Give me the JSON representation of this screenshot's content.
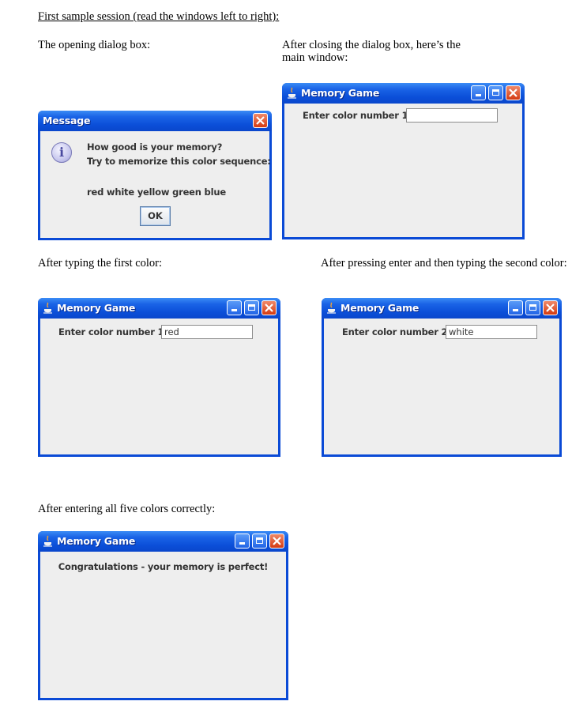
{
  "captions": {
    "heading": "First sample session (read the windows left to right):",
    "opening": "The opening dialog box:",
    "after_closing_1": "After closing the dialog box, here’s the",
    "after_closing_2": "main window:",
    "after_first": "After typing the first color:",
    "after_second": "After pressing enter and then typing the second color:",
    "after_all": "After entering all five colors correctly:"
  },
  "dialog": {
    "title": "Message",
    "line1": "How good is your memory?",
    "line2": "Try to memorize this color sequence:",
    "sequence": "red white yellow green blue",
    "ok_label": "OK",
    "icon": "info-icon"
  },
  "window_title": "Memory Game",
  "windows": {
    "main": {
      "label": "Enter color number 1:",
      "value": ""
    },
    "first": {
      "label": "Enter color number 1:",
      "value": "red"
    },
    "second": {
      "label": "Enter color number 2:",
      "value": "white"
    },
    "final": {
      "message": "Congratulations - your memory is perfect!"
    }
  },
  "colors": {
    "titlebar": "#0b4ed8",
    "close_button": "#d43b12",
    "client_bg": "#eeeeee"
  }
}
